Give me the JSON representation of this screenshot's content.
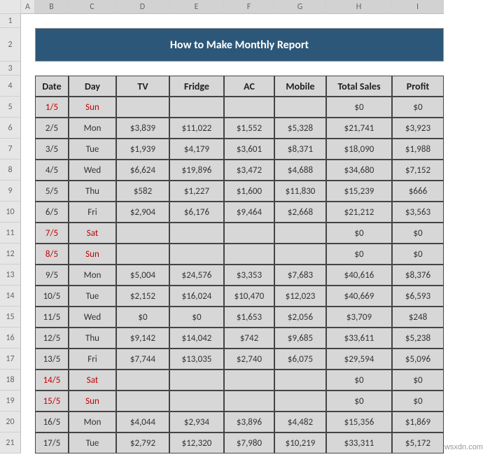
{
  "columns": [
    "A",
    "B",
    "C",
    "D",
    "E",
    "F",
    "G",
    "H",
    "I"
  ],
  "rows": [
    "1",
    "2",
    "3",
    "4",
    "5",
    "6",
    "7",
    "8",
    "9",
    "10",
    "11",
    "12",
    "13",
    "14",
    "15",
    "16",
    "17",
    "18",
    "19",
    "20",
    "21"
  ],
  "title": "How to Make Monthly Report",
  "headers": {
    "date": "Date",
    "day": "Day",
    "tv": "TV",
    "fridge": "Fridge",
    "ac": "AC",
    "mobile": "Mobile",
    "total": "Total Sales",
    "profit": "Profit"
  },
  "data": [
    {
      "date": "1/5",
      "day": "Sun",
      "tv": "",
      "fridge": "",
      "ac": "",
      "mobile": "",
      "total": "$0",
      "profit": "$0",
      "weekend": true
    },
    {
      "date": "2/5",
      "day": "Mon",
      "tv": "$3,839",
      "fridge": "$11,022",
      "ac": "$1,552",
      "mobile": "$5,328",
      "total": "$21,741",
      "profit": "$3,923",
      "weekend": false
    },
    {
      "date": "3/5",
      "day": "Tue",
      "tv": "$1,939",
      "fridge": "$4,179",
      "ac": "$3,601",
      "mobile": "$8,371",
      "total": "$18,090",
      "profit": "$1,988",
      "weekend": false
    },
    {
      "date": "4/5",
      "day": "Wed",
      "tv": "$6,624",
      "fridge": "$19,896",
      "ac": "$3,472",
      "mobile": "$4,688",
      "total": "$34,680",
      "profit": "$7,152",
      "weekend": false
    },
    {
      "date": "5/5",
      "day": "Thu",
      "tv": "$582",
      "fridge": "$1,227",
      "ac": "$1,600",
      "mobile": "$11,830",
      "total": "$15,239",
      "profit": "$666",
      "weekend": false
    },
    {
      "date": "6/5",
      "day": "Fri",
      "tv": "$2,904",
      "fridge": "$6,176",
      "ac": "$9,464",
      "mobile": "$2,668",
      "total": "$21,212",
      "profit": "$3,563",
      "weekend": false
    },
    {
      "date": "7/5",
      "day": "Sat",
      "tv": "",
      "fridge": "",
      "ac": "",
      "mobile": "",
      "total": "$0",
      "profit": "$0",
      "weekend": true
    },
    {
      "date": "8/5",
      "day": "Sun",
      "tv": "",
      "fridge": "",
      "ac": "",
      "mobile": "",
      "total": "$0",
      "profit": "$0",
      "weekend": true
    },
    {
      "date": "9/5",
      "day": "Mon",
      "tv": "$5,004",
      "fridge": "$24,576",
      "ac": "$3,353",
      "mobile": "$7,683",
      "total": "$40,616",
      "profit": "$8,376",
      "weekend": false
    },
    {
      "date": "10/5",
      "day": "Tue",
      "tv": "$2,152",
      "fridge": "$16,024",
      "ac": "$10,470",
      "mobile": "$12,023",
      "total": "$40,669",
      "profit": "$6,593",
      "weekend": false
    },
    {
      "date": "11/5",
      "day": "Wed",
      "tv": "$0",
      "fridge": "$0",
      "ac": "$1,653",
      "mobile": "$2,056",
      "total": "$3,709",
      "profit": "$248",
      "weekend": false
    },
    {
      "date": "12/5",
      "day": "Thu",
      "tv": "$9,142",
      "fridge": "$14,042",
      "ac": "$742",
      "mobile": "$9,685",
      "total": "$33,611",
      "profit": "$5,238",
      "weekend": false
    },
    {
      "date": "13/5",
      "day": "Fri",
      "tv": "$7,744",
      "fridge": "$13,035",
      "ac": "$2,740",
      "mobile": "$6,075",
      "total": "$29,594",
      "profit": "$5,096",
      "weekend": false
    },
    {
      "date": "14/5",
      "day": "Sat",
      "tv": "",
      "fridge": "",
      "ac": "",
      "mobile": "",
      "total": "$0",
      "profit": "$0",
      "weekend": true
    },
    {
      "date": "15/5",
      "day": "Sun",
      "tv": "",
      "fridge": "",
      "ac": "",
      "mobile": "",
      "total": "$0",
      "profit": "$0",
      "weekend": true
    },
    {
      "date": "16/5",
      "day": "Mon",
      "tv": "$4,044",
      "fridge": "$2,934",
      "ac": "$3,896",
      "mobile": "$4,482",
      "total": "$15,356",
      "profit": "$1,869",
      "weekend": false
    },
    {
      "date": "17/5",
      "day": "Tue",
      "tv": "$2,792",
      "fridge": "$12,320",
      "ac": "$7,980",
      "mobile": "$10,219",
      "total": "$33,311",
      "profit": "$5,172",
      "weekend": false
    }
  ],
  "watermark": "wsxdn.com"
}
